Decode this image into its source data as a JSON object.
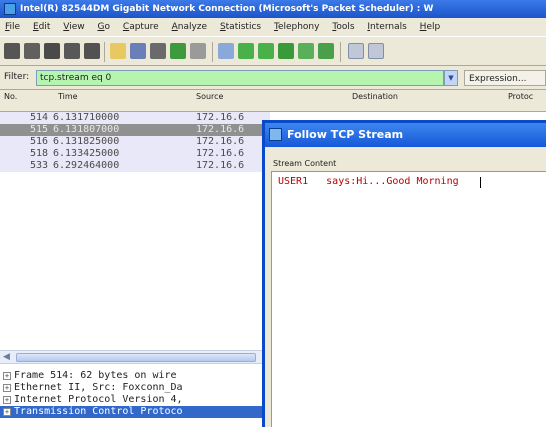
{
  "window": {
    "title": "Intel(R) 82544DM Gigabit Network Connection (Microsoft's Packet Scheduler) : W"
  },
  "menu": [
    "File",
    "Edit",
    "View",
    "Go",
    "Capture",
    "Analyze",
    "Statistics",
    "Telephony",
    "Tools",
    "Internals",
    "Help"
  ],
  "toolbar": {
    "icons": [
      "interface-list-icon",
      "capture-options-icon",
      "start-capture-icon",
      "stop-capture-icon",
      "restart-capture-icon",
      "open-file-icon",
      "save-file-icon",
      "close-file-icon",
      "reload-icon",
      "print-icon",
      "find-packet-icon",
      "go-back-icon",
      "go-forward-icon",
      "go-to-packet-icon",
      "go-first-icon",
      "go-last-icon",
      "colorize-icon",
      "auto-scroll-icon"
    ]
  },
  "filter": {
    "label": "Filter:",
    "value": "tcp.stream eq 0",
    "expression_label": "Expression...",
    "bg_color": "#b5f5b0"
  },
  "packet_list": {
    "columns": [
      "No.",
      "Time",
      "Source",
      "Destination",
      "Protoc"
    ],
    "rows": [
      {
        "no": "514",
        "time": "6.131710000",
        "source": "172.16.6",
        "selected": false
      },
      {
        "no": "515",
        "time": "6.131807000",
        "source": "172.16.6",
        "selected": true
      },
      {
        "no": "516",
        "time": "6.131825000",
        "source": "172.16.6",
        "selected": false
      },
      {
        "no": "518",
        "time": "6.133425000",
        "source": "172.16.6",
        "selected": false
      },
      {
        "no": "533",
        "time": "6.292464000",
        "source": "172.16.6",
        "selected": false
      }
    ]
  },
  "details": {
    "rows": [
      {
        "text": "Frame 514: 62 bytes on wire",
        "highlighted": false
      },
      {
        "text": "Ethernet II, Src: Foxconn_Da",
        "highlighted": false
      },
      {
        "text": "Internet Protocol Version 4,",
        "highlighted": false
      },
      {
        "text": "Transmission Control Protoco",
        "highlighted": true
      }
    ]
  },
  "dialog": {
    "title": "Follow TCP Stream",
    "group_label": "Stream Content",
    "content": "USER1   says:Hi...Good Morning",
    "content_color": "#b80000"
  }
}
